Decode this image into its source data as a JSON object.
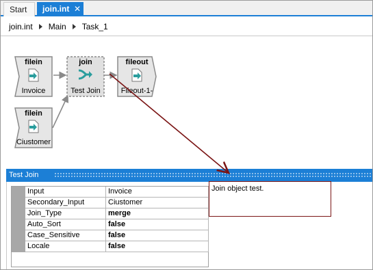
{
  "tabs": [
    {
      "label": "Start",
      "active": false
    },
    {
      "label": "join.int",
      "active": true,
      "close_glyph": "✕"
    }
  ],
  "breadcrumb": [
    "join.int",
    "Main",
    "Task_1"
  ],
  "canvas": {
    "nodes": [
      {
        "type": "filein",
        "name": "Invoice",
        "icon": "file-arrow-in-icon"
      },
      {
        "type": "join",
        "name": "Test Join",
        "icon": "join-arrow-icon",
        "selected": true
      },
      {
        "type": "fileout",
        "name": "Fileout-1-",
        "icon": "file-arrow-out-icon"
      },
      {
        "type": "filein",
        "name": "Ciustomer",
        "icon": "file-arrow-in-icon"
      }
    ]
  },
  "panel": {
    "title": "Test Join",
    "properties": [
      {
        "name": "Input",
        "value": "Invoice",
        "bold": false
      },
      {
        "name": "Secondary_Input",
        "value": "Ciustomer",
        "bold": false
      },
      {
        "name": "Join_Type",
        "value": "merge",
        "bold": true
      },
      {
        "name": "Auto_Sort",
        "value": "false",
        "bold": true
      },
      {
        "name": "Case_Sensitive",
        "value": "false",
        "bold": true
      },
      {
        "name": "Locale",
        "value": "false",
        "bold": true
      }
    ],
    "comment": "Join object test."
  },
  "colors": {
    "accent": "#1c7fd6",
    "node_fill": "#e6e6e6",
    "node_border": "#8a8a8a",
    "icon_teal": "#2a9d9d",
    "annotation_line": "#7a1414"
  }
}
